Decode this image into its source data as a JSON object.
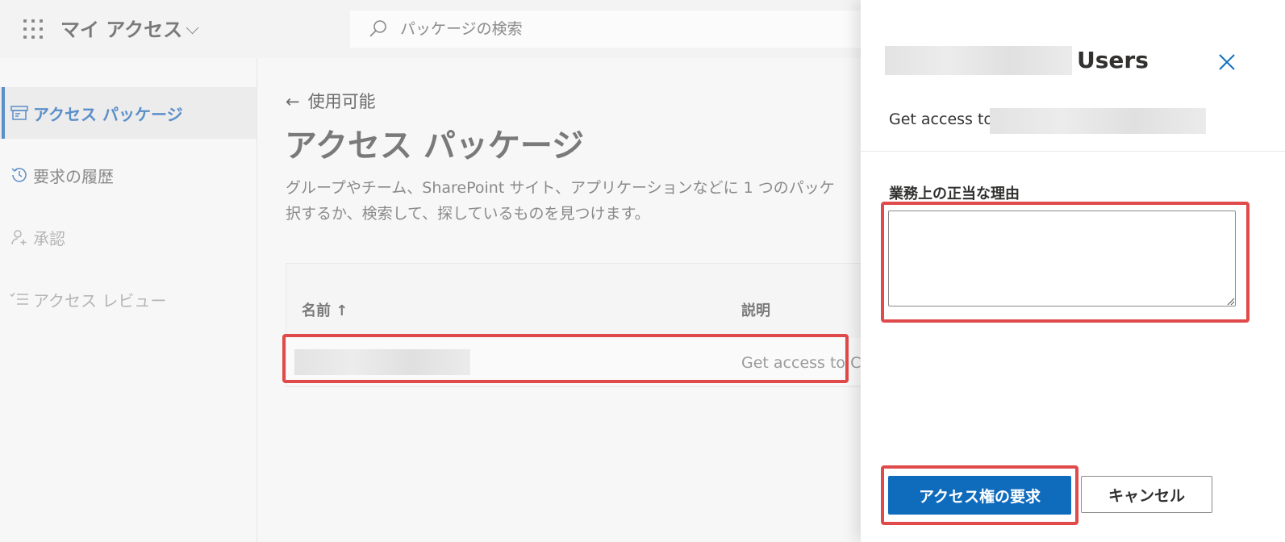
{
  "topbar": {
    "app_title": "マイ アクセス",
    "search_placeholder": "パッケージの検索"
  },
  "sidebar": {
    "items": [
      {
        "label": "アクセス パッケージ",
        "icon": "package-icon",
        "state": "active"
      },
      {
        "label": "要求の履歴",
        "icon": "history-icon",
        "state": "normal"
      },
      {
        "label": "承認",
        "icon": "person-add-icon",
        "state": "disabled"
      },
      {
        "label": "アクセス レビュー",
        "icon": "checklist-icon",
        "state": "disabled"
      }
    ]
  },
  "main": {
    "back_label": "使用可能",
    "title": "アクセス パッケージ",
    "description_line1": "グループやチーム、SharePoint サイト、アプリケーションなどに 1 つのパッケ",
    "description_line2": "択するか、検索して、探しているものを見つけます。",
    "table": {
      "col_name": "名前 ↑",
      "col_desc": "説明",
      "rows": [
        {
          "description": "Get access to Co"
        }
      ]
    }
  },
  "panel": {
    "title_suffix": "Users",
    "get_access_prefix": "Get access to",
    "field_label": "業務上の正当な理由",
    "primary_button": "アクセス権の要求",
    "secondary_button": "キャンセル"
  },
  "colors": {
    "accent": "#0f6cbd",
    "nav_active": "#5b8fc9",
    "highlight": "#e04a4a"
  }
}
